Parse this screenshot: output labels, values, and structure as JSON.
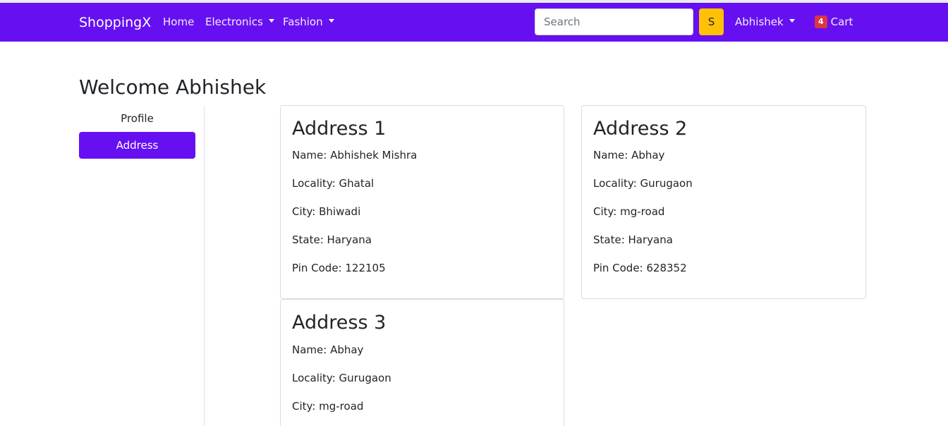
{
  "navbar": {
    "brand": "ShoppingX",
    "home": "Home",
    "electronics": "Electronics",
    "fashion": "Fashion",
    "search_placeholder": "Search",
    "search_button": "S",
    "user": "Abhishek",
    "cart_count": "4",
    "cart_label": "Cart",
    "bg_color": "#6610f2"
  },
  "page": {
    "welcome": "Welcome Abhishek"
  },
  "sidebar": {
    "items": [
      {
        "label": "Profile",
        "active": false
      },
      {
        "label": "Address",
        "active": true
      }
    ]
  },
  "addresses": [
    {
      "title": "Address 1",
      "name": "Name: Abhishek Mishra",
      "locality": "Locality: Ghatal",
      "city": "City: Bhiwadi",
      "state": "State: Haryana",
      "pin": "Pin Code: 122105"
    },
    {
      "title": "Address 2",
      "name": "Name: Abhay",
      "locality": "Locality: Gurugaon",
      "city": "City: mg-road",
      "state": "State: Haryana",
      "pin": "Pin Code: 628352"
    },
    {
      "title": "Address 3",
      "name": "Name: Abhay",
      "locality": "Locality: Gurugaon",
      "city": "City: mg-road"
    }
  ]
}
